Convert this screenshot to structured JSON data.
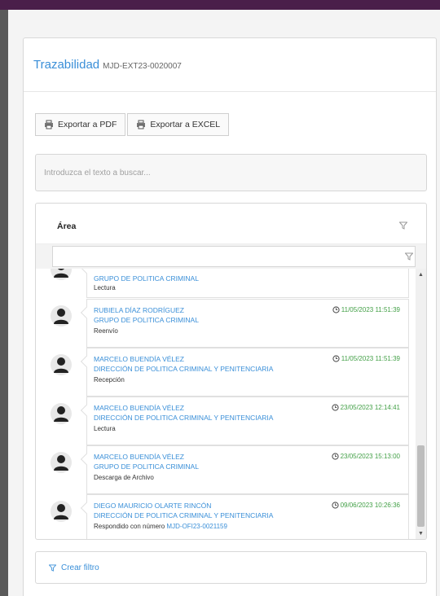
{
  "panel": {
    "title": "Trazabilidad",
    "subtitle": "MJD-EXT23-0020007"
  },
  "toolbar": {
    "export_pdf": "Exportar a PDF",
    "export_excel": "Exportar a EXCEL"
  },
  "search": {
    "placeholder": "Introduzca el texto a buscar..."
  },
  "grid": {
    "column_header": "Área",
    "rows": [
      {
        "lines": [
          "GRUPO DE POLITICA CRIMINAL"
        ],
        "action": "Lectura",
        "timestamp": ""
      },
      {
        "lines": [
          "RUBIELA DÍAZ RODRÍGUEZ",
          "GRUPO DE POLITICA CRIMINAL"
        ],
        "action": "Reenvío",
        "timestamp": "11/05/2023 11:51:39"
      },
      {
        "lines": [
          "MARCELO BUENDÍA VÉLEZ",
          "DIRECCIÓN DE POLITICA CRIMINAL Y PENITENCIARIA"
        ],
        "action": "Recepción",
        "timestamp": "11/05/2023 11:51:39"
      },
      {
        "lines": [
          "MARCELO BUENDÍA VÉLEZ",
          "DIRECCIÓN DE POLITICA CRIMINAL Y PENITENCIARIA"
        ],
        "action": "Lectura",
        "timestamp": "23/05/2023 12:14:41"
      },
      {
        "lines": [
          "MARCELO BUENDÍA VÉLEZ",
          "GRUPO DE POLITICA CRIMINAL"
        ],
        "action": "Descarga de Archivo",
        "timestamp": "23/05/2023 15:13:00"
      },
      {
        "lines": [
          "DIEGO MAURICIO OLARTE RINCÓN",
          "DIRECCIÓN DE POLITICA CRIMINAL Y PENITENCIARIA"
        ],
        "action": "Respondido con número",
        "link": "MJD-OFI23-0021159",
        "timestamp": "09/06/2023 10:26:36"
      }
    ]
  },
  "footer": {
    "create_filter": "Crear filtro"
  },
  "colors": {
    "accent": "#3a8fd8",
    "timestamp": "#43a047",
    "top_bar": "#4a1f4a"
  }
}
